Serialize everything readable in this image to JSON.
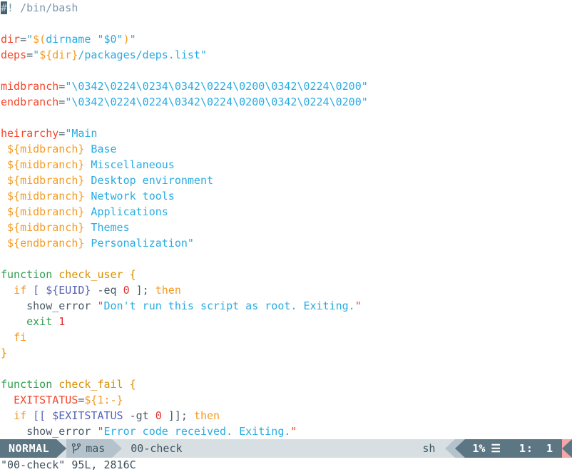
{
  "editor": {
    "lines": [
      {
        "id": "shebang",
        "tokens": [
          {
            "c": "cursor",
            "t": "#"
          },
          {
            "c": "t-comment",
            "t": "! /bin/bash"
          }
        ]
      },
      {
        "id": "blank1",
        "tokens": [
          {
            "c": "t-plain",
            "t": ""
          }
        ]
      },
      {
        "id": "dir-assign",
        "tokens": [
          {
            "c": "t-var",
            "t": "dir"
          },
          {
            "c": "t-op",
            "t": "="
          },
          {
            "c": "t-string",
            "t": "\""
          },
          {
            "c": "t-subst",
            "t": "$("
          },
          {
            "c": "t-string",
            "t": "dirname "
          },
          {
            "c": "t-string",
            "t": "\"$0\""
          },
          {
            "c": "t-subst",
            "t": ")"
          },
          {
            "c": "t-string",
            "t": "\""
          }
        ]
      },
      {
        "id": "deps-assign",
        "tokens": [
          {
            "c": "t-var",
            "t": "deps"
          },
          {
            "c": "t-op",
            "t": "="
          },
          {
            "c": "t-string",
            "t": "\""
          },
          {
            "c": "t-subst",
            "t": "${dir}"
          },
          {
            "c": "t-string",
            "t": "/packages/deps.list\""
          }
        ]
      },
      {
        "id": "blank2",
        "tokens": [
          {
            "c": "t-plain",
            "t": ""
          }
        ]
      },
      {
        "id": "midbranch",
        "tokens": [
          {
            "c": "t-var",
            "t": "midbranch"
          },
          {
            "c": "t-op",
            "t": "="
          },
          {
            "c": "t-string",
            "t": "\"\\0342\\0224\\0234\\0342\\0224\\0200\\0342\\0224\\0200\""
          }
        ]
      },
      {
        "id": "endbranch",
        "tokens": [
          {
            "c": "t-var",
            "t": "endbranch"
          },
          {
            "c": "t-op",
            "t": "="
          },
          {
            "c": "t-string",
            "t": "\"\\0342\\0224\\0224\\0342\\0224\\0200\\0342\\0224\\0200\""
          }
        ]
      },
      {
        "id": "blank3",
        "tokens": [
          {
            "c": "t-plain",
            "t": ""
          }
        ]
      },
      {
        "id": "heirarchy-open",
        "tokens": [
          {
            "c": "t-var",
            "t": "heirarchy"
          },
          {
            "c": "t-op",
            "t": "="
          },
          {
            "c": "t-string",
            "t": "\"Main"
          }
        ]
      },
      {
        "id": "h-base",
        "tokens": [
          {
            "c": "t-string",
            "t": " "
          },
          {
            "c": "t-subst",
            "t": "${midbranch}"
          },
          {
            "c": "t-string",
            "t": " Base"
          }
        ]
      },
      {
        "id": "h-misc",
        "tokens": [
          {
            "c": "t-string",
            "t": " "
          },
          {
            "c": "t-subst",
            "t": "${midbranch}"
          },
          {
            "c": "t-string",
            "t": " Miscellaneous"
          }
        ]
      },
      {
        "id": "h-desktop",
        "tokens": [
          {
            "c": "t-string",
            "t": " "
          },
          {
            "c": "t-subst",
            "t": "${midbranch}"
          },
          {
            "c": "t-string",
            "t": " Desktop environment"
          }
        ]
      },
      {
        "id": "h-network",
        "tokens": [
          {
            "c": "t-string",
            "t": " "
          },
          {
            "c": "t-subst",
            "t": "${midbranch}"
          },
          {
            "c": "t-string",
            "t": " Network tools"
          }
        ]
      },
      {
        "id": "h-apps",
        "tokens": [
          {
            "c": "t-string",
            "t": " "
          },
          {
            "c": "t-subst",
            "t": "${midbranch}"
          },
          {
            "c": "t-string",
            "t": " Applications"
          }
        ]
      },
      {
        "id": "h-themes",
        "tokens": [
          {
            "c": "t-string",
            "t": " "
          },
          {
            "c": "t-subst",
            "t": "${midbranch}"
          },
          {
            "c": "t-string",
            "t": " Themes"
          }
        ]
      },
      {
        "id": "h-personal",
        "tokens": [
          {
            "c": "t-string",
            "t": " "
          },
          {
            "c": "t-subst",
            "t": "${endbranch}"
          },
          {
            "c": "t-string",
            "t": " Personalization\""
          }
        ]
      },
      {
        "id": "blank4",
        "tokens": [
          {
            "c": "t-plain",
            "t": ""
          }
        ]
      },
      {
        "id": "fn-check-user",
        "tokens": [
          {
            "c": "t-function",
            "t": "function "
          },
          {
            "c": "t-funcname",
            "t": "check_user "
          },
          {
            "c": "t-brace",
            "t": "{"
          }
        ]
      },
      {
        "id": "cu-if",
        "tokens": [
          {
            "c": "t-plain",
            "t": "  "
          },
          {
            "c": "t-keyword",
            "t": "if "
          },
          {
            "c": "t-cond",
            "t": "[ ${EUID}"
          },
          {
            "c": "t-plain",
            "t": " -eq "
          },
          {
            "c": "t-number",
            "t": "0"
          },
          {
            "c": "t-plain",
            "t": " ]; "
          },
          {
            "c": "t-keyword",
            "t": "then"
          }
        ]
      },
      {
        "id": "cu-show-error",
        "tokens": [
          {
            "c": "t-plain",
            "t": "    show_error "
          },
          {
            "c": "t-quote",
            "t": "\""
          },
          {
            "c": "t-string",
            "t": "Don't run this script as root. Exiting."
          },
          {
            "c": "t-quote",
            "t": "\""
          }
        ]
      },
      {
        "id": "cu-exit",
        "tokens": [
          {
            "c": "t-plain",
            "t": "    "
          },
          {
            "c": "t-builtin",
            "t": "exit "
          },
          {
            "c": "t-number",
            "t": "1"
          }
        ]
      },
      {
        "id": "cu-fi",
        "tokens": [
          {
            "c": "t-plain",
            "t": "  "
          },
          {
            "c": "t-keyword",
            "t": "fi"
          }
        ]
      },
      {
        "id": "cu-close",
        "tokens": [
          {
            "c": "t-brace",
            "t": "}"
          }
        ]
      },
      {
        "id": "blank5",
        "tokens": [
          {
            "c": "t-plain",
            "t": ""
          }
        ]
      },
      {
        "id": "fn-check-fail",
        "tokens": [
          {
            "c": "t-function",
            "t": "function "
          },
          {
            "c": "t-funcname",
            "t": "check_fail "
          },
          {
            "c": "t-brace",
            "t": "{"
          }
        ]
      },
      {
        "id": "cf-exitstatus",
        "tokens": [
          {
            "c": "t-plain",
            "t": "  "
          },
          {
            "c": "t-var",
            "t": "EXITSTATUS"
          },
          {
            "c": "t-op",
            "t": "="
          },
          {
            "c": "t-subst",
            "t": "${1:-}"
          }
        ]
      },
      {
        "id": "cf-if",
        "tokens": [
          {
            "c": "t-plain",
            "t": "  "
          },
          {
            "c": "t-keyword",
            "t": "if "
          },
          {
            "c": "t-cond",
            "t": "[[ $EXITSTATUS"
          },
          {
            "c": "t-plain",
            "t": " -gt "
          },
          {
            "c": "t-number",
            "t": "0"
          },
          {
            "c": "t-plain",
            "t": " ]]; "
          },
          {
            "c": "t-keyword",
            "t": "then"
          }
        ]
      },
      {
        "id": "cf-show-error",
        "tokens": [
          {
            "c": "t-plain",
            "t": "    show_error "
          },
          {
            "c": "t-quote",
            "t": "\""
          },
          {
            "c": "t-string",
            "t": "Error code received. Exiting."
          },
          {
            "c": "t-quote",
            "t": "\""
          }
        ]
      }
    ]
  },
  "statusline": {
    "mode": "NORMAL",
    "branch_icon": "git-branch-icon",
    "branch": "mas",
    "filename": "00-check",
    "filetype": "sh",
    "percent": "1%",
    "scroll_icon": "☰",
    "line_label": "1:",
    "column": "1"
  },
  "cmdline": {
    "message": "\"00-check\" 95L, 2816C"
  },
  "colors": {
    "mode_bg": "#5d7684",
    "branch_bg": "#b4c3cb",
    "file_bg": "#d7dfe3",
    "right_bg": "#5d7684",
    "accent_end": "#f4a6a6",
    "background": "#ffffff"
  }
}
